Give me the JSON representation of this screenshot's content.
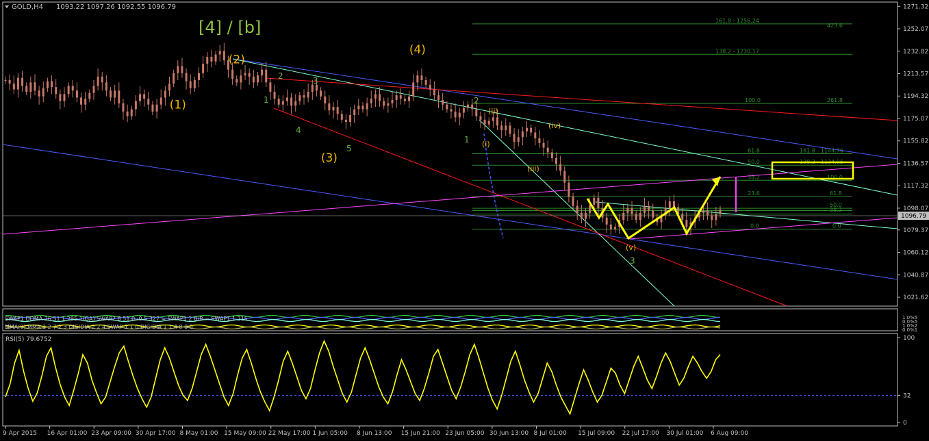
{
  "header": {
    "symbol": "GOLD,H4",
    "ohlc": "1093.22 1097.26 1092.55 1096.79"
  },
  "chart_title": "[4] / [b]",
  "chart_data": [
    {
      "type": "line",
      "panel": "price",
      "ylim": [
        1014,
        1275
      ],
      "y_ticks": [
        "1271.32",
        "1252.07",
        "1232.82",
        "1213.57",
        "1194.32",
        "1175.07",
        "1155.82",
        "1136.57",
        "1117.32",
        "1098.07",
        "1079.37",
        "1060.12",
        "1040.87",
        "1021.62"
      ],
      "current_price": "1096.79",
      "series": [
        {
          "values": [
            1208,
            1205,
            1200,
            1210,
            1203,
            1198,
            1206,
            1199,
            1194,
            1201,
            1207,
            1202,
            1196,
            1190,
            1196,
            1203,
            1199,
            1193,
            1187,
            1192,
            1197,
            1203,
            1211,
            1206,
            1199,
            1193,
            1199,
            1188,
            1181,
            1177,
            1183,
            1190,
            1196,
            1192,
            1187,
            1181,
            1187,
            1193,
            1199,
            1205,
            1214,
            1220,
            1214,
            1207,
            1201,
            1208,
            1214,
            1222,
            1228,
            1224,
            1230,
            1233,
            1225,
            1217,
            1209,
            1206,
            1212,
            1214,
            1211,
            1206,
            1212,
            1217,
            1206,
            1198,
            1192,
            1187,
            1190,
            1193,
            1186,
            1190,
            1195,
            1193,
            1198,
            1204,
            1199,
            1194,
            1188,
            1182,
            1185,
            1179,
            1174,
            1172,
            1178,
            1183,
            1186,
            1183,
            1188,
            1192,
            1196,
            1190,
            1186,
            1188,
            1191,
            1195,
            1192,
            1190,
            1194,
            1206,
            1212,
            1208,
            1204,
            1200,
            1195,
            1191,
            1187,
            1183,
            1181,
            1176,
            1180,
            1184,
            1187,
            1183,
            1177,
            1174,
            1170,
            1173,
            1176,
            1169,
            1165,
            1169,
            1162,
            1155,
            1159,
            1164,
            1167,
            1163,
            1158,
            1154,
            1150,
            1146,
            1141,
            1136,
            1130,
            1120,
            1108,
            1100,
            1094,
            1089,
            1094,
            1101,
            1107,
            1098,
            1090,
            1084,
            1080,
            1082,
            1088,
            1094,
            1098,
            1093,
            1088,
            1094,
            1100,
            1096,
            1090,
            1086,
            1092,
            1098,
            1104,
            1099,
            1093,
            1088,
            1082,
            1086,
            1090,
            1094,
            1096,
            1092,
            1088,
            1093,
            1097
          ]
        }
      ],
      "wave_labels_orange": [
        "(1)",
        "(2)",
        "(3)",
        "(4)"
      ],
      "wave_labels_green": [
        "1",
        "2",
        "3",
        "4",
        "5",
        "1",
        "2",
        "3"
      ],
      "wave_labels_roman": [
        "(i)",
        "(ii)",
        "(iii)",
        "(iv)",
        "(v)"
      ],
      "fib_upper": [
        "161.8 - 1256.24",
        "423.6",
        "138.2 - 1230.17",
        "100.0",
        "261.8",
        "61.8",
        "161.8 - 1144.76",
        "50.0",
        "138.2 - 1134.95",
        "38.2",
        "100.0",
        "23.6",
        "61.8"
      ],
      "fib_lower": [
        "50.0",
        "38.2",
        "0.0",
        "0.0"
      ]
    },
    {
      "type": "line",
      "panel": "oscillator",
      "legend_1": "SWAP1 DDMA 26 51 1 295 1(GA) SWAP2 8 51 0 -0.5 327 = SWAP1 2 B/B = SWAP1 1 215",
      "legend_2": "MMA(9) MMA 1 2 7 2 3 DIGIDIA 2 2 4 SWAP 1 1 0 DIGIDIA 1 1 4 8 0 0",
      "right_labels": [
        "1.0%5",
        "0.0%5",
        "1.0%2",
        "0.0%1"
      ]
    },
    {
      "type": "line",
      "panel": "rsi",
      "title": "RSI(5) 79.6752",
      "ylim": [
        0,
        100
      ],
      "y_ticks": [
        "100",
        "32",
        "0"
      ],
      "level": 32,
      "series": [
        {
          "values": [
            30,
            45,
            70,
            85,
            60,
            40,
            25,
            35,
            55,
            78,
            88,
            65,
            45,
            30,
            20,
            38,
            58,
            80,
            70,
            50,
            35,
            22,
            30,
            48,
            66,
            82,
            90,
            72,
            55,
            40,
            28,
            18,
            30,
            52,
            74,
            88,
            76,
            60,
            44,
            32,
            26,
            40,
            60,
            80,
            92,
            78,
            62,
            46,
            30,
            20,
            34,
            56,
            76,
            86,
            70,
            52,
            36,
            24,
            14,
            30,
            50,
            72,
            84,
            70,
            54,
            38,
            28,
            40,
            62,
            82,
            96,
            84,
            66,
            50,
            34,
            24,
            36,
            56,
            76,
            88,
            74,
            58,
            42,
            30,
            22,
            36,
            56,
            74,
            62,
            48,
            34,
            26,
            40,
            58,
            78,
            86,
            70,
            54,
            38,
            28,
            42,
            60,
            80,
            92,
            76,
            58,
            40,
            26,
            16,
            32,
            52,
            72,
            84,
            68,
            50,
            36,
            24,
            34,
            52,
            70,
            60,
            44,
            30,
            20,
            10,
            28,
            46,
            62,
            50,
            36,
            24,
            32,
            48,
            64,
            58,
            44,
            34,
            50,
            66,
            78,
            64,
            50,
            40,
            54,
            70,
            82,
            72,
            58,
            44,
            52,
            66,
            78,
            70,
            60,
            52,
            60,
            74,
            80
          ]
        }
      ]
    }
  ],
  "x_axis": {
    "labels": [
      "9 Apr 2015",
      "16 Apr 01:00",
      "23 Apr 09:00",
      "30 Apr 17:00",
      "8 May 01:00",
      "15 May 09:00",
      "22 May 17:00",
      "1 Jun 05:00",
      "8 Jun 13:00",
      "15 Jun 21:00",
      "23 Jun 05:00",
      "30 Jun 13:00",
      "8 Jul 01:00",
      "15 Jul 09:00",
      "22 Jul 17:00",
      "30 Jul 01:00",
      "6 Aug 09:00"
    ]
  },
  "colors": {
    "background": "#000000",
    "foreground": "#c0c0c0",
    "candles": "#c87a6a",
    "title": "#8fc043",
    "wave_orange": "#f0b400",
    "wave_green": "#6cb33c",
    "rsi": "#ffff00",
    "projection": "#ffff00",
    "box": "#ffff00",
    "magenta": "#ff44ff",
    "red_line": "#ff1a1a",
    "blue_line": "#4a5cff",
    "teal_line": "#7fffd4",
    "fib": "#2e8b2e"
  }
}
